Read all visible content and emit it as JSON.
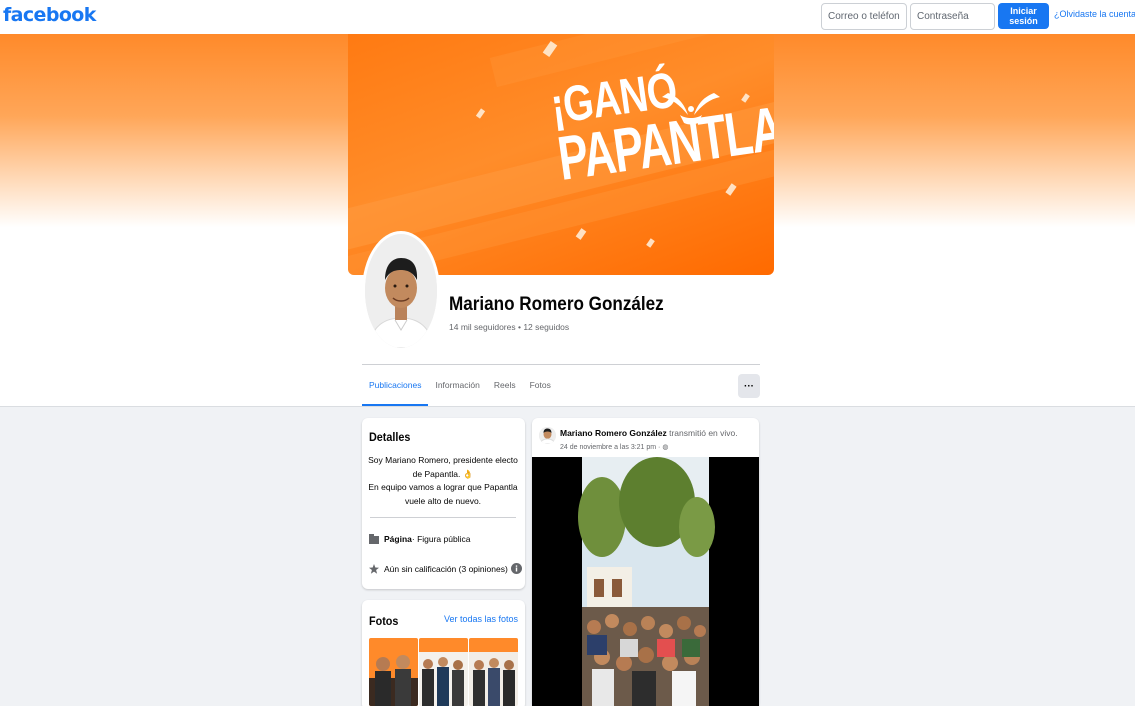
{
  "topbar": {
    "logo": "facebook",
    "email_placeholder": "Correo o teléfono",
    "password_placeholder": "Contraseña",
    "login_label": "Iniciar sesión",
    "forgot_label": "¿Olvidaste la cuenta?"
  },
  "cover": {
    "line1": "¡GANÓ",
    "line2": "PAPANTLA!"
  },
  "profile": {
    "name": "Mariano Romero González",
    "stats": "14 mil seguidores • 12 seguidos"
  },
  "tabs": [
    {
      "label": "Publicaciones",
      "active": true
    },
    {
      "label": "Información"
    },
    {
      "label": "Reels"
    },
    {
      "label": "Fotos"
    }
  ],
  "more_label": "···",
  "details": {
    "title": "Detalles",
    "bio_line1": "Soy Mariano Romero, presidente electo de Papantla. 👌",
    "bio_line2": "En equipo vamos a lograr que Papantla vuele alto de nuevo.",
    "page_type_bold": "Página",
    "page_type_rest": " · Figura pública",
    "rating": "Aún sin calificación (3 opiniones)"
  },
  "photos": {
    "title": "Fotos",
    "see_all": "Ver todas las fotos"
  },
  "post": {
    "author": "Mariano Romero González",
    "action": " transmitió en vivo.",
    "time": "24 de noviembre a las 3:21 pm · "
  },
  "colors": {
    "brand": "#1877f2",
    "cover_orange": "#ff7a12"
  }
}
